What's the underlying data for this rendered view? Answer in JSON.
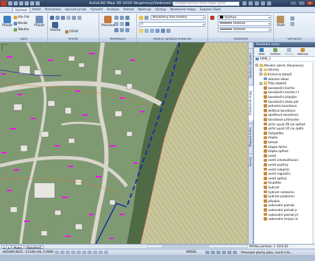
{
  "window": {
    "title": "AutoCAD Map 3D 2010    Skupinovy/Vodovod.dwg",
    "search_placeholder": "Zadejte klíčové slovo nebo výraz"
  },
  "ribbon_tabs": [
    "Výchozí",
    "Vložit",
    "Poznámka",
    "Upravit prvek",
    "Vytvořit",
    "Analýza",
    "Pohled",
    "Nástroje",
    "Výstup",
    "Nastavení mapy",
    "Express Tools"
  ],
  "ribbon": {
    "data_panel": {
      "label": "Data",
      "connect": "Připojit",
      "map_explorer": "Vše Filtr",
      "search": "Hledat",
      "table": "Tabulka"
    },
    "attach_panel": {
      "attach": "Připojit"
    },
    "draw_panel": {
      "label": "Kreslit",
      "line": "Úsečka",
      "circle": "COGO"
    },
    "modify_panel": {
      "label": "Modifikace",
      "move": "Posunout"
    },
    "layers_panel": {
      "label": "Hladiny aplikace AutoCAD",
      "layer_state": "Neuložený stav hladiny",
      "current_layer": "0"
    },
    "properties_panel": {
      "label": "Vlastnosti",
      "color": "DleHlad",
      "linetype": "DleHlad",
      "lineweight": "DleHlad"
    },
    "clipboard_panel": {
      "label": "Schránka",
      "paste": "Vložit"
    }
  },
  "palette_side_tabs": [
    "Správce zobrazení",
    "Průzkumník mapy",
    "Mapová kniha",
    "Survey"
  ],
  "task_pane": {
    "title": "Podoklad úlohy",
    "toolbar": [
      "Data",
      "Schéma",
      "Tabulka",
      "Nástroje"
    ],
    "drawing": "KIMS_1",
    "tree": [
      {
        "label": "Aktuální výkres (Skupinový)",
        "level": 0,
        "icon": "folder"
      },
      {
        "label": "Výkresy",
        "level": 1,
        "icon": "folder"
      },
      {
        "label": "Knihovna dotazů",
        "level": 1,
        "icon": "folder"
      },
      {
        "label": "Aktuální dotaz",
        "level": 2,
        "icon": "query"
      },
      {
        "label": "Třídy objektů",
        "level": 1,
        "icon": "folder"
      },
      {
        "label": "kanalizační šachta",
        "level": 2,
        "icon": "class"
      },
      {
        "label": "kanalizační šachta z t",
        "level": 2,
        "icon": "class"
      },
      {
        "label": "kanalizační přípojka",
        "level": 2,
        "icon": "class"
      },
      {
        "label": "kanalizační stoka pot",
        "level": 2,
        "icon": "class"
      },
      {
        "label": "jednotná kanalizace",
        "level": 2,
        "icon": "class"
      },
      {
        "label": "dešťová kanalizace",
        "level": 2,
        "icon": "class"
      },
      {
        "label": "splašková kanalizace",
        "level": 2,
        "icon": "class"
      },
      {
        "label": "kanalizace průmyslov",
        "level": 2,
        "icon": "class"
      },
      {
        "label": "uliční vpust ZK (ze zpětné",
        "level": 2,
        "icon": "class"
      },
      {
        "label": "uliční vpust VZ (se zpětn",
        "level": 2,
        "icon": "class"
      },
      {
        "label": "čistipolítko",
        "level": 2,
        "icon": "class"
      },
      {
        "label": "klapka",
        "level": 2,
        "icon": "class"
      },
      {
        "label": "kohout",
        "level": 2,
        "icon": "class"
      },
      {
        "label": "klapka škrticí",
        "level": 2,
        "icon": "class"
      },
      {
        "label": "klapka zpětná",
        "level": 2,
        "icon": "class"
      },
      {
        "label": "ventil",
        "level": 2,
        "icon": "class"
      },
      {
        "label": "ventil odvzdušňovací",
        "level": 2,
        "icon": "class"
      },
      {
        "label": "ventil pojistný",
        "level": 2,
        "icon": "class"
      },
      {
        "label": "ventil redukční",
        "level": 2,
        "icon": "class"
      },
      {
        "label": "ventil regulační",
        "level": 2,
        "icon": "class"
      },
      {
        "label": "ventil zpětný",
        "level": 2,
        "icon": "class"
      },
      {
        "label": "šoupátko",
        "level": 2,
        "icon": "class"
      },
      {
        "label": "hydrant",
        "level": 2,
        "icon": "class"
      },
      {
        "label": "hydrant nadzemní",
        "level": 2,
        "icon": "class"
      },
      {
        "label": "hydrant podzemní",
        "level": 2,
        "icon": "class"
      },
      {
        "label": "přípojka",
        "level": 2,
        "icon": "class"
      },
      {
        "label": "vodovodní potrubí",
        "level": 2,
        "icon": "class"
      },
      {
        "label": "vodovodní potrubí p",
        "level": 2,
        "icon": "class"
      },
      {
        "label": "vodovodní potrubí př",
        "level": 2,
        "icon": "class"
      },
      {
        "label": "vodovodní čerpací st",
        "level": 2,
        "icon": "class"
      }
    ]
  },
  "layout_tabs": [
    "Model",
    "Rozvržení1"
  ],
  "viewport_tab": "Model",
  "status_pane": "Měřítko pohledu: 1: 2252.83",
  "statusbar": {
    "coordinates": "-845000.0025, -1110E+06, 0.0000",
    "mode": "MODEL",
    "message": "Přecování plochy pásu, rovně a ta..."
  },
  "colors": {
    "accent": "#243a58",
    "map_pipe": "#1a2aa8",
    "map_labels": "#ff00ff",
    "field": "#c8c59a"
  }
}
